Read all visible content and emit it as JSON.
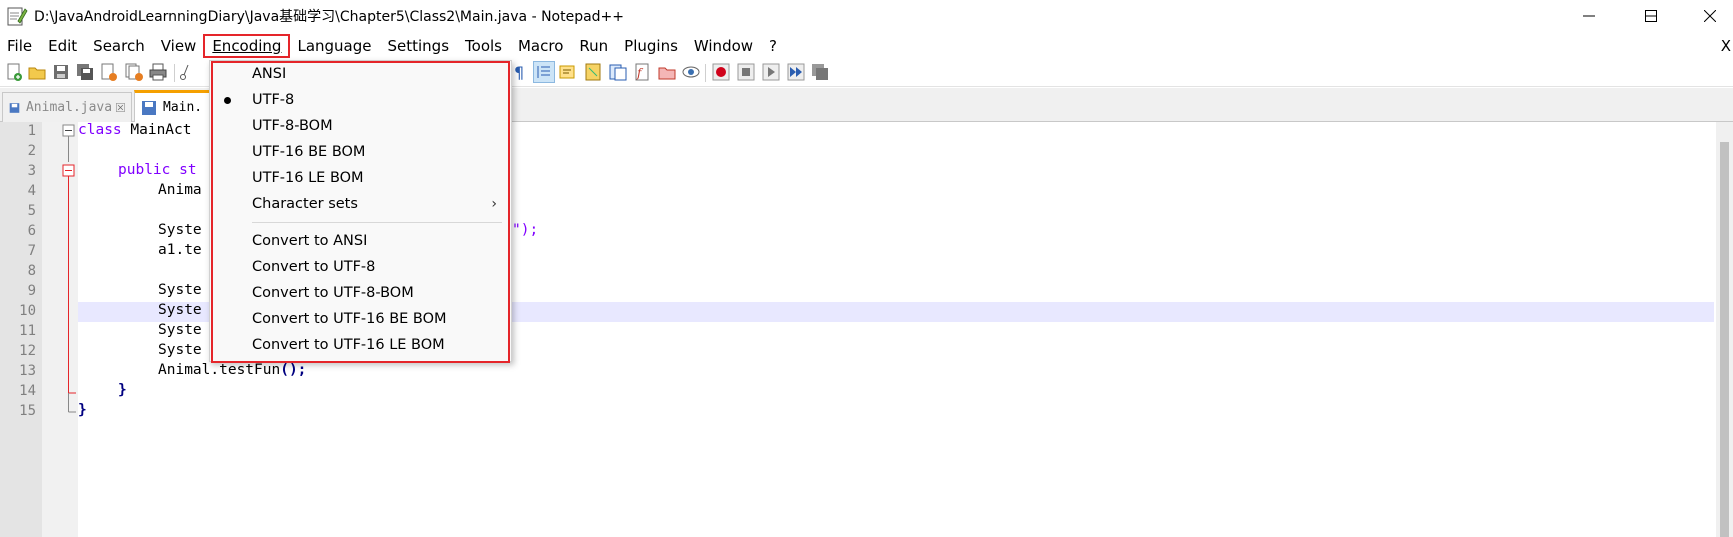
{
  "window": {
    "title": "D:\\JavaAndroidLearnningDiary\\Java基础学习\\Chapter5\\Class2\\Main.java - Notepad++",
    "minimize_icon": "minimize-icon",
    "maximize_icon": "maximize-icon",
    "close_icon": "close-icon"
  },
  "menubar": {
    "items": [
      "File",
      "Edit",
      "Search",
      "View",
      "Encoding",
      "Language",
      "Settings",
      "Tools",
      "Macro",
      "Run",
      "Plugins",
      "Window",
      "?"
    ],
    "active": "Encoding",
    "close_label": "X"
  },
  "tabs": [
    {
      "label": "Animal.java",
      "active": false
    },
    {
      "label": "Main.",
      "active": true
    }
  ],
  "editor": {
    "line_numbers": [
      "1",
      "2",
      "3",
      "4",
      "5",
      "6",
      "7",
      "8",
      "9",
      "10",
      "11",
      "12",
      "13",
      "14",
      "15"
    ],
    "lines": {
      "l1_kw": "class",
      "l1_rest": " MainAct",
      "l3_kw": "public st",
      "l4": "Anima",
      "l6": "Syste",
      "l6_tail": "\");",
      "l7": "a1.te",
      "l9": "Syste",
      "l10": "Syste",
      "l11": "Syste",
      "l12": "Syste",
      "l13_text": "Animal.testFun",
      "l13_ops": "();",
      "l14": "}",
      "l15": "}"
    },
    "highlighted_line": 10
  },
  "encoding_menu": {
    "items": [
      {
        "label": "ANSI",
        "checked": false
      },
      {
        "label": "UTF-8",
        "checked": true
      },
      {
        "label": "UTF-8-BOM",
        "checked": false
      },
      {
        "label": "UTF-16 BE BOM",
        "checked": false
      },
      {
        "label": "UTF-16 LE BOM",
        "checked": false
      },
      {
        "label": "Character sets",
        "submenu": true
      }
    ],
    "convert_items": [
      "Convert to ANSI",
      "Convert to UTF-8",
      "Convert to UTF-8-BOM",
      "Convert to UTF-16 BE BOM",
      "Convert to UTF-16 LE BOM"
    ],
    "submenu_arrow": "›"
  },
  "colors": {
    "highlight_red": "#e5252a",
    "keyword": "#8000ff",
    "operator": "#000080",
    "active_tab_accent": "#f5a000",
    "current_line": "#e8e8ff"
  }
}
